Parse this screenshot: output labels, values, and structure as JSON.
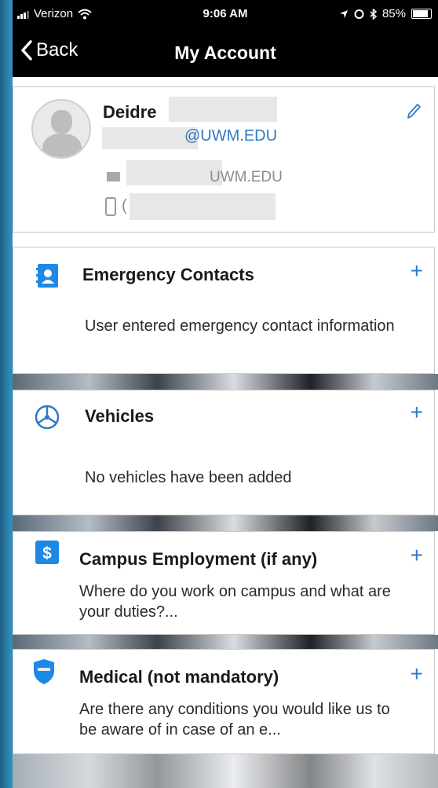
{
  "status_bar": {
    "carrier": "Verizon",
    "time": "9:06 AM",
    "battery": "85%"
  },
  "nav": {
    "back_label": "Back",
    "title": "My Account"
  },
  "profile": {
    "first_name": "Deidre",
    "email": "@UWM.EDU",
    "secondary_email": "UWM.EDU",
    "phone_prefix": "("
  },
  "sections": [
    {
      "title": "Emergency Contacts",
      "description": "User entered emergency contact information",
      "icon": "contact-book-icon",
      "action": "+"
    },
    {
      "title": "Vehicles",
      "description": "No vehicles have been added",
      "icon": "steering-wheel-icon",
      "action": "+"
    },
    {
      "title": "Campus Employment (if any)",
      "description": "Where do you work on campus and what are your duties?...",
      "icon": "dollar-icon",
      "action": "+"
    },
    {
      "title": "Medical (not mandatory)",
      "description": "Are there any conditions you would like us to be aware of in case of an e...",
      "icon": "shield-icon",
      "action": "+"
    }
  ],
  "colors": {
    "accent": "#2f79c4",
    "icon_blue": "#1e88e5",
    "bar": "#000000"
  }
}
